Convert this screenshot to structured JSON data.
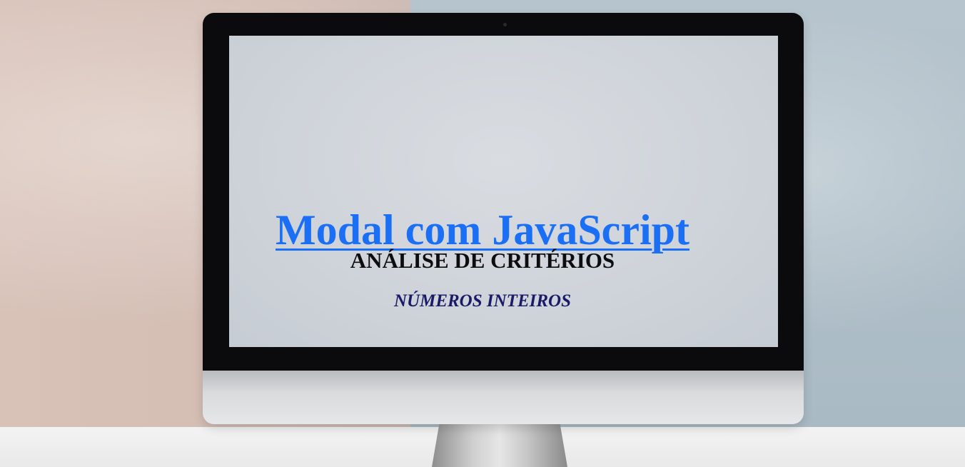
{
  "page": {
    "title_link": "Modal com JavaScript",
    "subtitle": "ANÁLISE DE CRITÉRIOS",
    "tagline": "NÚMEROS INTEIROS"
  },
  "colors": {
    "title_link": "#1a6ff5",
    "subtitle": "#0d0d10",
    "tagline": "#1a1a66"
  }
}
